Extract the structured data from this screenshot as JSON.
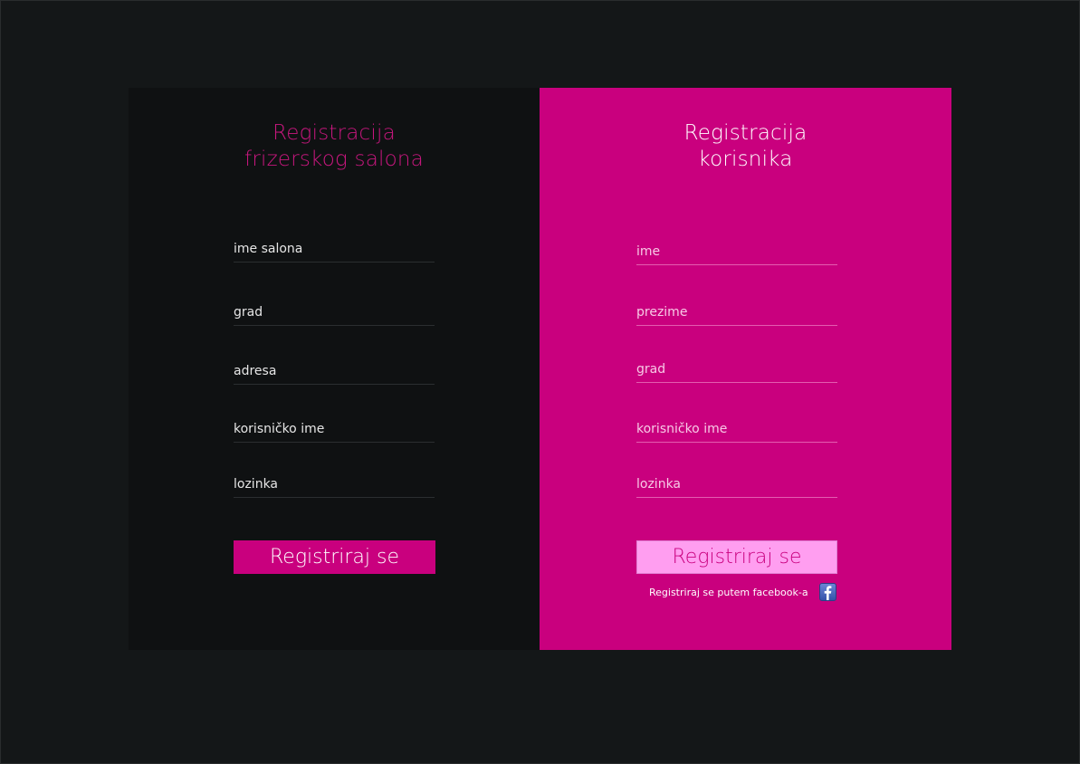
{
  "salon": {
    "title_line1": "Registracija",
    "title_line2": "frizerskog salona",
    "fields": [
      "ime salona",
      "grad",
      "adresa",
      "korisničko ime",
      "lozinka"
    ],
    "button_label": "Registriraj se"
  },
  "user": {
    "title_line1": "Registracija",
    "title_line2": "korisnika",
    "fields": [
      "ime",
      "prezime",
      "grad",
      "korisničko ime",
      "lozinka"
    ],
    "button_label": "Registriraj se",
    "facebook_label": "Registriraj se putem facebook-a",
    "facebook_icon": "facebook-icon"
  },
  "colors": {
    "accent": "#c9007e",
    "button_light": "#ff9ef0",
    "panel_dark": "#0f1112",
    "background": "#141718"
  }
}
